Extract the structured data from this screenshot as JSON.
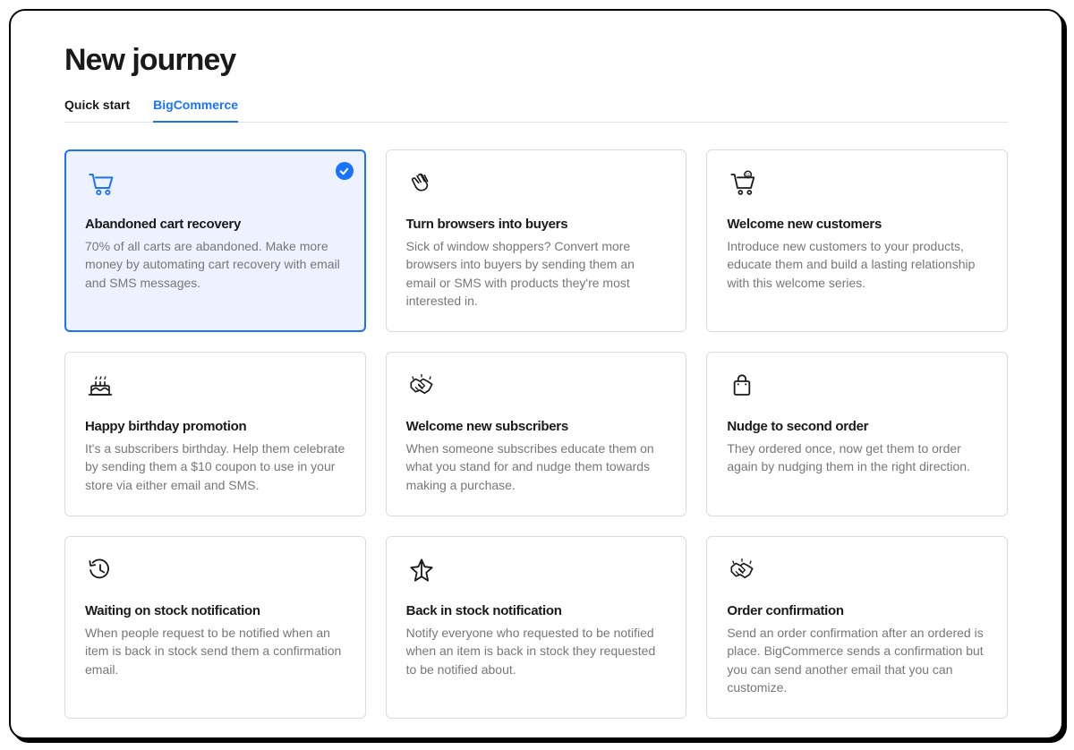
{
  "page": {
    "title": "New journey"
  },
  "tabs": [
    {
      "label": "Quick start",
      "active": false
    },
    {
      "label": "BigCommerce",
      "active": true
    }
  ],
  "cards": [
    {
      "icon": "cart-icon",
      "title": "Abandoned cart recovery",
      "desc": "70% of all carts are abandoned. Make more money by automating cart recovery with email and SMS messages.",
      "selected": true
    },
    {
      "icon": "wave-icon",
      "title": "Turn browsers into buyers",
      "desc": "Sick of window shoppers? Convert more browsers into buyers by sending them an email or SMS with products they're most interested in.",
      "selected": false
    },
    {
      "icon": "cart-smile-icon",
      "title": "Welcome new customers",
      "desc": "Introduce new customers to your products, educate them and build a lasting relationship with this welcome series.",
      "selected": false
    },
    {
      "icon": "cake-icon",
      "title": "Happy birthday promotion",
      "desc": "It's a subscribers birthday. Help them celebrate by sending them a $10 coupon to use in your store via either email and SMS.",
      "selected": false
    },
    {
      "icon": "handshake-icon",
      "title": "Welcome new subscribers",
      "desc": "When someone subscribes educate them on what you stand for and nudge them towards making a purchase.",
      "selected": false
    },
    {
      "icon": "bag-icon",
      "title": "Nudge to second order",
      "desc": "They ordered once, now get them to order again by nudging them in the right direction.",
      "selected": false
    },
    {
      "icon": "clock-back-icon",
      "title": "Waiting on stock notification",
      "desc": "When people request to be notified when an item is back in stock send them a confirmation email.",
      "selected": false
    },
    {
      "icon": "star-icon",
      "title": "Back in stock notification",
      "desc": "Notify everyone who requested to be notified when an item is back in stock they requested to be notified about.",
      "selected": false
    },
    {
      "icon": "handshake-icon",
      "title": "Order confirmation",
      "desc": "Send an order confirmation after an ordered is place. BigCommerce sends a confirmation but you can send another email that you can customize.",
      "selected": false
    }
  ]
}
